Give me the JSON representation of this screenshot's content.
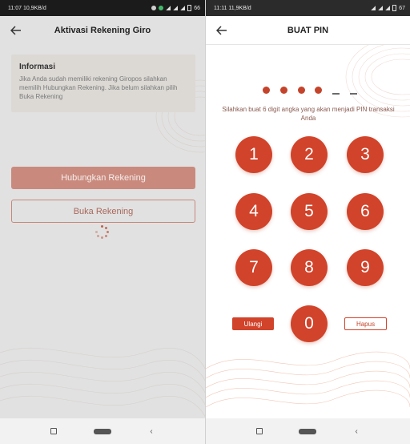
{
  "left_screen": {
    "status_time": "11:07 10,9KB/d",
    "battery": "66",
    "title": "Aktivasi Rekening Giro",
    "info": {
      "title": "Informasi",
      "text": "Jika Anda sudah memiliki rekening Giropos silahkan memilih Hubungkan Rekening. Jika belum silahkan pilih Buka Rekening"
    },
    "buttons": {
      "connect": "Hubungkan Rekening",
      "open": "Buka Rekening"
    }
  },
  "right_screen": {
    "status_time": "11:11 11,9KB/d",
    "battery": "67",
    "title": "BUAT PIN",
    "pin_filled": 4,
    "pin_length": 6,
    "instruction": "Silahkan buat 6 digit angka yang akan menjadi PIN transaksi Anda",
    "keys": [
      "1",
      "2",
      "3",
      "4",
      "5",
      "6",
      "7",
      "8",
      "9",
      "0"
    ],
    "reset_label": "Ulangi",
    "delete_label": "Hapus"
  },
  "colors": {
    "accent": "#d1432a",
    "overlay_gray": "#e1e1e1"
  },
  "icons": {
    "back": "arrow-left-icon",
    "nav_recent": "square-icon",
    "nav_home": "pill-icon",
    "nav_back": "chevron-left-icon"
  }
}
